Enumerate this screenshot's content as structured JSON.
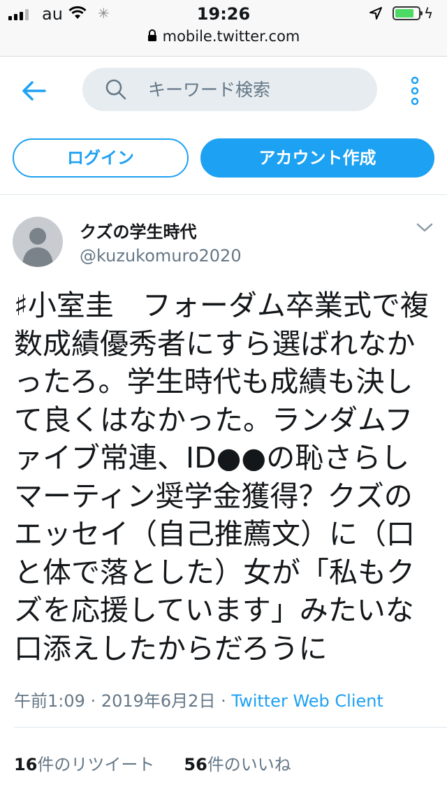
{
  "status_bar": {
    "carrier": "au",
    "time": "19:26",
    "battery_level": 0.8
  },
  "browser": {
    "url": "mobile.twitter.com"
  },
  "header": {
    "back_icon": "arrow-left-icon",
    "search_placeholder": "キーワード検索",
    "more_icon": "vertical-dots-icon"
  },
  "auth": {
    "login_label": "ログイン",
    "signup_label": "アカウント作成"
  },
  "tweet": {
    "display_name": "クズの学生時代",
    "handle": "@kuzukomuro2020",
    "text": "♯小室圭　フォーダム卒業式で複数成績優秀者にすら選ばれなかったろ。学生時代も成績も決して良くはなかった。ランダムファイブ常連、ID●●の恥さらしマーティン奨学金獲得？クズのエッセイ（自己推薦文）に（口と体で落とした）女が「私もクズを応援しています」みたいな口添えしたからだろうに",
    "time": "午前1:09",
    "date": "2019年6月2日",
    "separator": "·",
    "client": "Twitter Web Client",
    "retweet_count": "16",
    "retweet_label": "件のリツイート",
    "like_count": "56",
    "like_label": "件のいいね"
  },
  "colors": {
    "accent": "#1da1f2",
    "muted": "#657786",
    "search_bg": "#e6ecf0"
  }
}
